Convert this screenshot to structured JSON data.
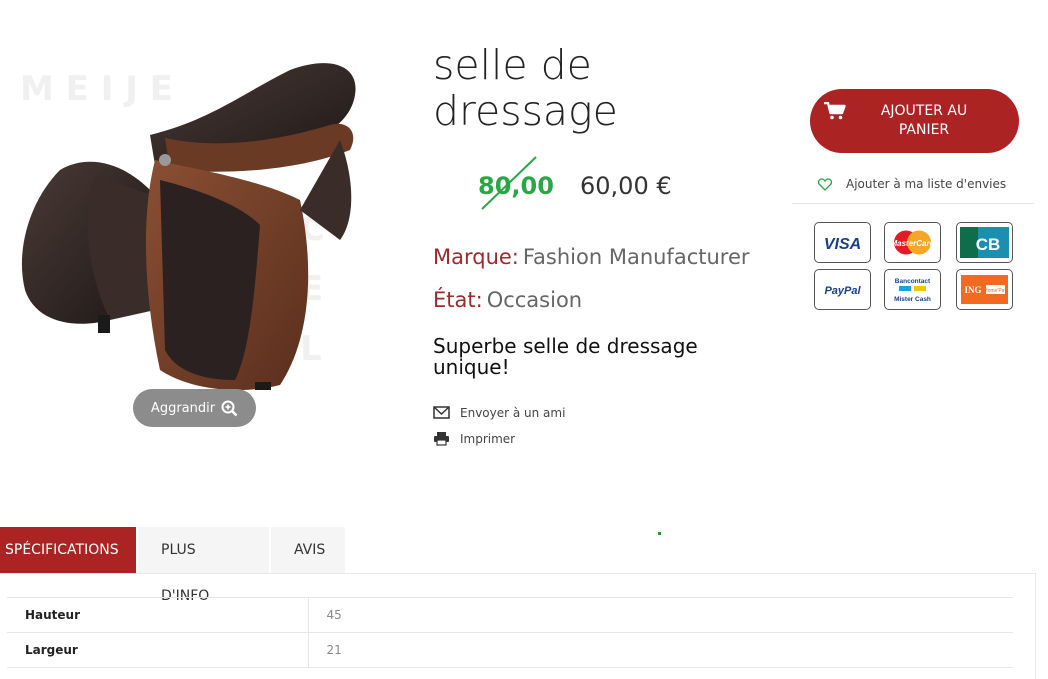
{
  "product": {
    "title_line1": "selle de",
    "title_line2": "dressage",
    "old_price": "80,00",
    "price": "60,00 €",
    "brand_label": "Marque:",
    "brand_value": "Fashion Manufacturer",
    "condition_label": "État:",
    "condition_value": "Occasion",
    "description_line1": "Superbe selle de dressage",
    "description_line2": "unique!"
  },
  "image": {
    "zoom_label": "Aggrandir"
  },
  "links": {
    "send_friend": "Envoyer à un ami",
    "print": "Imprimer",
    "wishlist": "Ajouter à ma liste d'envies"
  },
  "cart": {
    "label_line1": "AJOUTER AU",
    "label_line2": "PANIER"
  },
  "payment_methods": [
    "VISA",
    "MasterCard",
    "CB",
    "PayPal",
    "Bancontact Mister Cash",
    "ING Home'Pay"
  ],
  "tabs": [
    {
      "label": "SPÉCIFICATIONS",
      "active": true
    },
    {
      "label": "PLUS D'INFO",
      "active": false
    },
    {
      "label": "AVIS",
      "active": false
    }
  ],
  "specs": [
    {
      "name": "Hauteur",
      "value": "45"
    },
    {
      "name": "Largeur",
      "value": "21"
    }
  ],
  "colors": {
    "accent": "#ab2323",
    "old_price": "#29a745",
    "label": "#9b2a2a"
  }
}
